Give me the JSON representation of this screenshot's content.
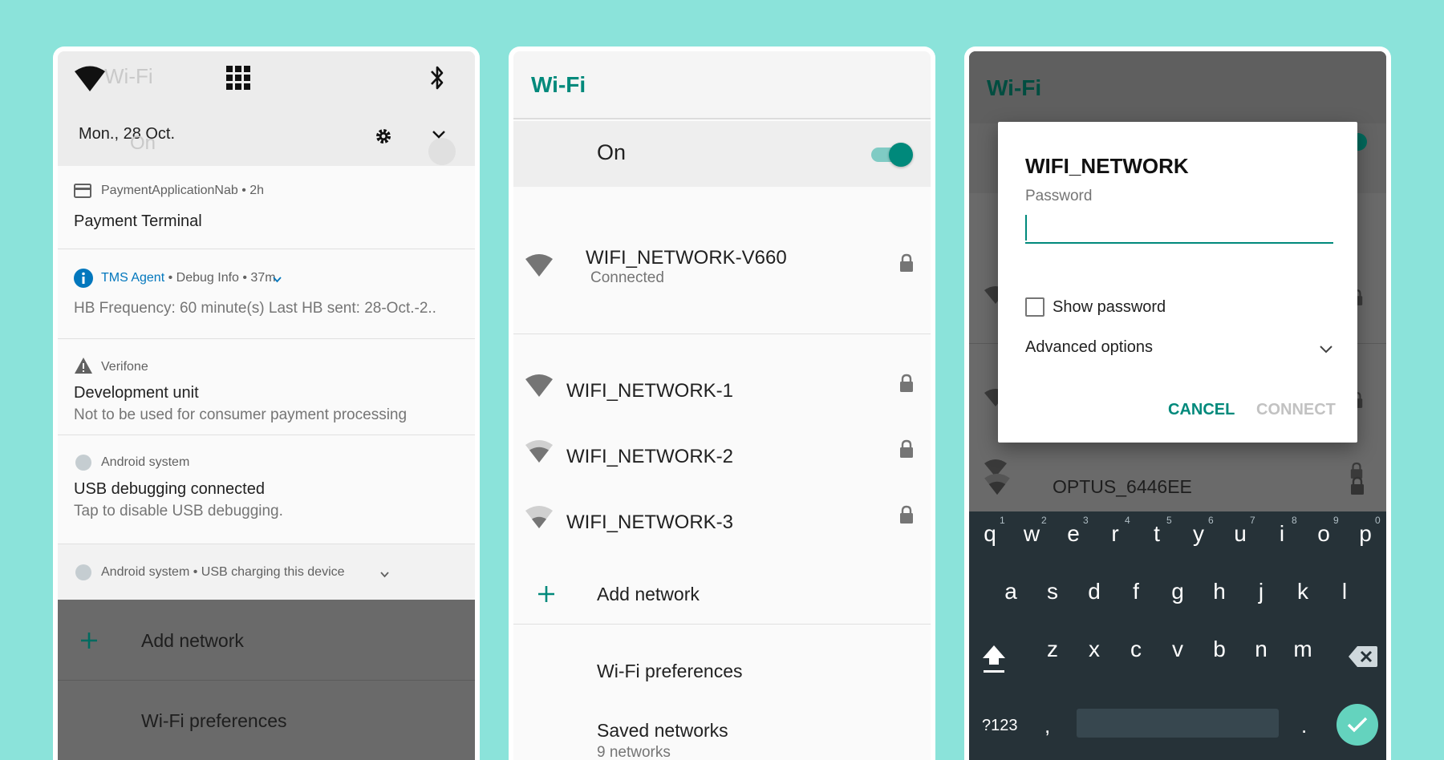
{
  "colors": {
    "background": "#8be3da",
    "accent": "#00897b",
    "dark_overlay": "#6a6a6a",
    "keyboard": "#263238"
  },
  "panel1": {
    "quick_settings": {
      "ghost_title": "Wi-Fi",
      "ghost_on": "On",
      "date": "Mon., 28 Oct.",
      "icons": [
        "wifi-icon",
        "apps-grid-icon",
        "bluetooth-icon",
        "settings-gear-icon",
        "chevron-down-icon"
      ]
    },
    "notifications": [
      {
        "meta": "PaymentApplicationNab • 2h",
        "title": "Payment Terminal"
      },
      {
        "app": "TMS Agent",
        "meta": " • Debug Info • 37m",
        "body": "HB Frequency: 60 minute(s) Last HB sent: 28-Oct.-2.."
      },
      {
        "meta": "Verifone",
        "title": "Development unit",
        "body": "Not to be used for consumer payment processing"
      },
      {
        "meta": "Android system",
        "title": "USB debugging connected",
        "body": "Tap to disable USB debugging."
      },
      {
        "meta": "Android system • USB charging this device"
      }
    ],
    "background_items": {
      "add_network": "Add network",
      "wifi_preferences": "Wi-Fi preferences"
    }
  },
  "panel2": {
    "title": "Wi-Fi",
    "toggle_label": "On",
    "toggle_state": "on",
    "networks": [
      {
        "name": "WIFI_NETWORK-V660",
        "status": "Connected"
      },
      {
        "name": "WIFI_NETWORK-1"
      },
      {
        "name": "WIFI_NETWORK-2"
      },
      {
        "name": "WIFI_NETWORK-3"
      }
    ],
    "add_network": "Add network",
    "wifi_preferences": "Wi-Fi preferences",
    "saved_networks": "Saved networks",
    "saved_count": "9 networks"
  },
  "panel3": {
    "title": "Wi-Fi",
    "background_network": "OPTUS_6446EE",
    "dialog": {
      "title": "WIFI_NETWORK",
      "password_label": "Password",
      "password_value": "",
      "show_password": "Show password",
      "advanced_options": "Advanced options",
      "cancel": "CANCEL",
      "connect": "CONNECT"
    },
    "keyboard": {
      "row1": [
        "q",
        "w",
        "e",
        "r",
        "t",
        "y",
        "u",
        "i",
        "o",
        "p"
      ],
      "row1_hints": [
        "1",
        "2",
        "3",
        "4",
        "5",
        "6",
        "7",
        "8",
        "9",
        "0"
      ],
      "row2": [
        "a",
        "s",
        "d",
        "f",
        "g",
        "h",
        "j",
        "k",
        "l"
      ],
      "row3": [
        "z",
        "x",
        "c",
        "v",
        "b",
        "n",
        "m"
      ],
      "symbols": "?123",
      "comma": ",",
      "period": "."
    }
  }
}
